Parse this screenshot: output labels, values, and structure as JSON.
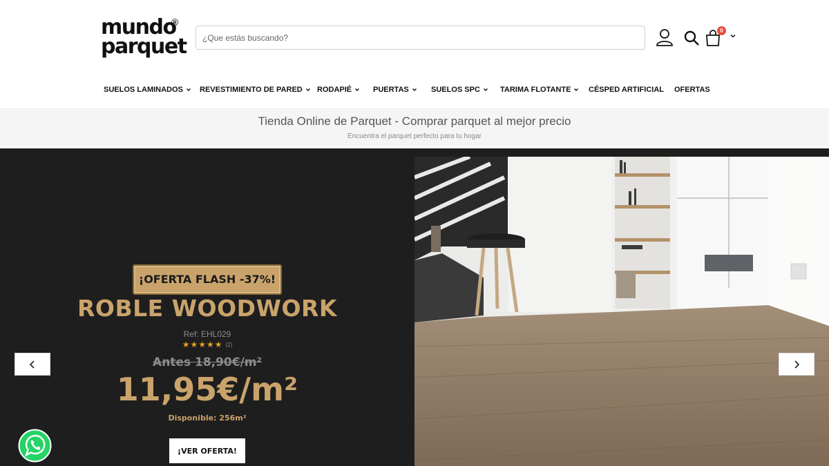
{
  "header": {
    "logo_line1": "mundo",
    "logo_line2": "parquet",
    "logo_mark": "®",
    "search_placeholder": "¿Que estás buscando?",
    "cart_count": "0",
    "icons": [
      "user-icon",
      "search-icon",
      "cart-icon",
      "chevron-down-icon"
    ]
  },
  "nav": {
    "items": [
      {
        "label": "SUELOS LAMINADOS",
        "dropdown": true
      },
      {
        "label": "REVESTIMIENTO DE PARED",
        "dropdown": true
      },
      {
        "label": "RODAPIÉ",
        "dropdown": true
      },
      {
        "label": "PUERTAS",
        "dropdown": true
      },
      {
        "label": "SUELOS SPC",
        "dropdown": true
      },
      {
        "label": "TARIMA FLOTANTE",
        "dropdown": true
      },
      {
        "label": "CÉSPED ARTIFICIAL",
        "dropdown": false
      },
      {
        "label": "OFERTAS",
        "dropdown": false
      }
    ]
  },
  "band": {
    "title": "Tienda Online de Parquet - Comprar parquet al mejor precio",
    "subtitle": "Encuentra el parquet perfecto para tu hogar"
  },
  "hero": {
    "badge": "¡OFERTA FLASH -37%!",
    "product_name": "ROBLE WOODWORK",
    "ref": "Ref: EHL029",
    "stars": "★★★★★",
    "rating": 5,
    "review_count": "(2)",
    "old_price": "Antes 18,90€/m²",
    "new_price": "11,95€/m²",
    "availability": "Disponible: 256m²",
    "cta_label": "¡VER OFERTA!"
  },
  "colors": {
    "gold": "#c9a36b",
    "hero_bg": "#1e1e1e",
    "badge_red": "#e84c3d",
    "whatsapp_green": "#25d366"
  }
}
